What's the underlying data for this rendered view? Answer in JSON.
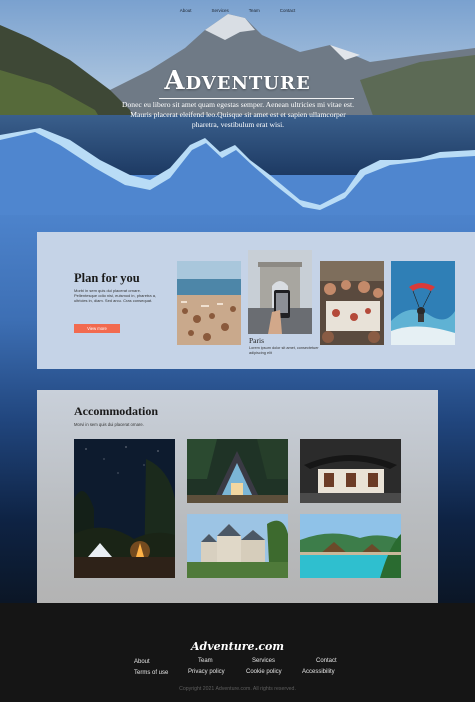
{
  "nav": {
    "items": [
      "About",
      "Services",
      "Team",
      "Contact"
    ]
  },
  "hero": {
    "title": "Adventure",
    "subtitle": "Donec eu libero sit amet quam egestas semper. Aenean ultricies mi vitae est. Mauris placerat eleifend leo.Quisque sit amet est et sapien ullamcorper pharetra, vestibulum erat wisi."
  },
  "plan": {
    "heading": "Plan for you",
    "text": "Morbi in sem quis dui placerat ornare. Pellentesque odio nisi, euismod in, pharetra a, ultricies in, diam. Sed arcu. Cras consequat.",
    "button": "View more",
    "featured_caption": "Paris",
    "featured_text": "Lorem ipsum dolor sit amet, consectetuer adipiscing elit"
  },
  "accommodation": {
    "heading": "Accommodation",
    "text": "Morvi in sem quis dui placerat ornare."
  },
  "footer": {
    "brand": "Adventure.com",
    "links": [
      "About",
      "Team",
      "Services",
      "Contact",
      "Terms of use",
      "Privacy policy",
      "Cookie policy",
      "Accessibility"
    ],
    "copyright": "Copyright 2021 Adventure.com. All rights reserved."
  },
  "colors": {
    "accent": "#f26a4f",
    "primary_blue": "#4f86cf",
    "card_bg": "#c5d3e7",
    "footer_bg": "#151515"
  }
}
